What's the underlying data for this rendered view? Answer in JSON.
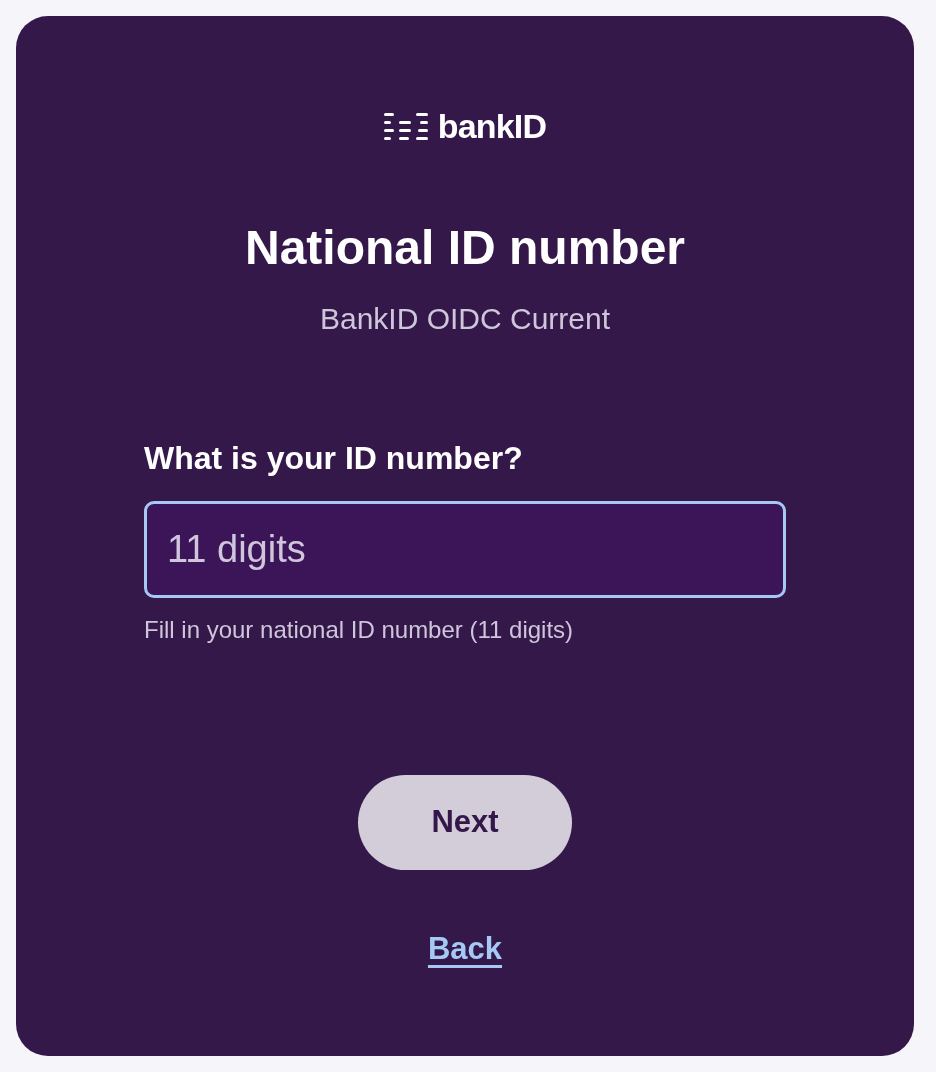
{
  "logo": {
    "text": "bankID"
  },
  "title": "National ID number",
  "subtitle": "BankID OIDC Current",
  "field": {
    "label": "What is your ID number?",
    "placeholder": "11 digits",
    "focused": true,
    "help": "Fill in your national ID number (11 digits)"
  },
  "primary_button": {
    "label": "Next"
  },
  "back_link": {
    "label": "Back"
  }
}
